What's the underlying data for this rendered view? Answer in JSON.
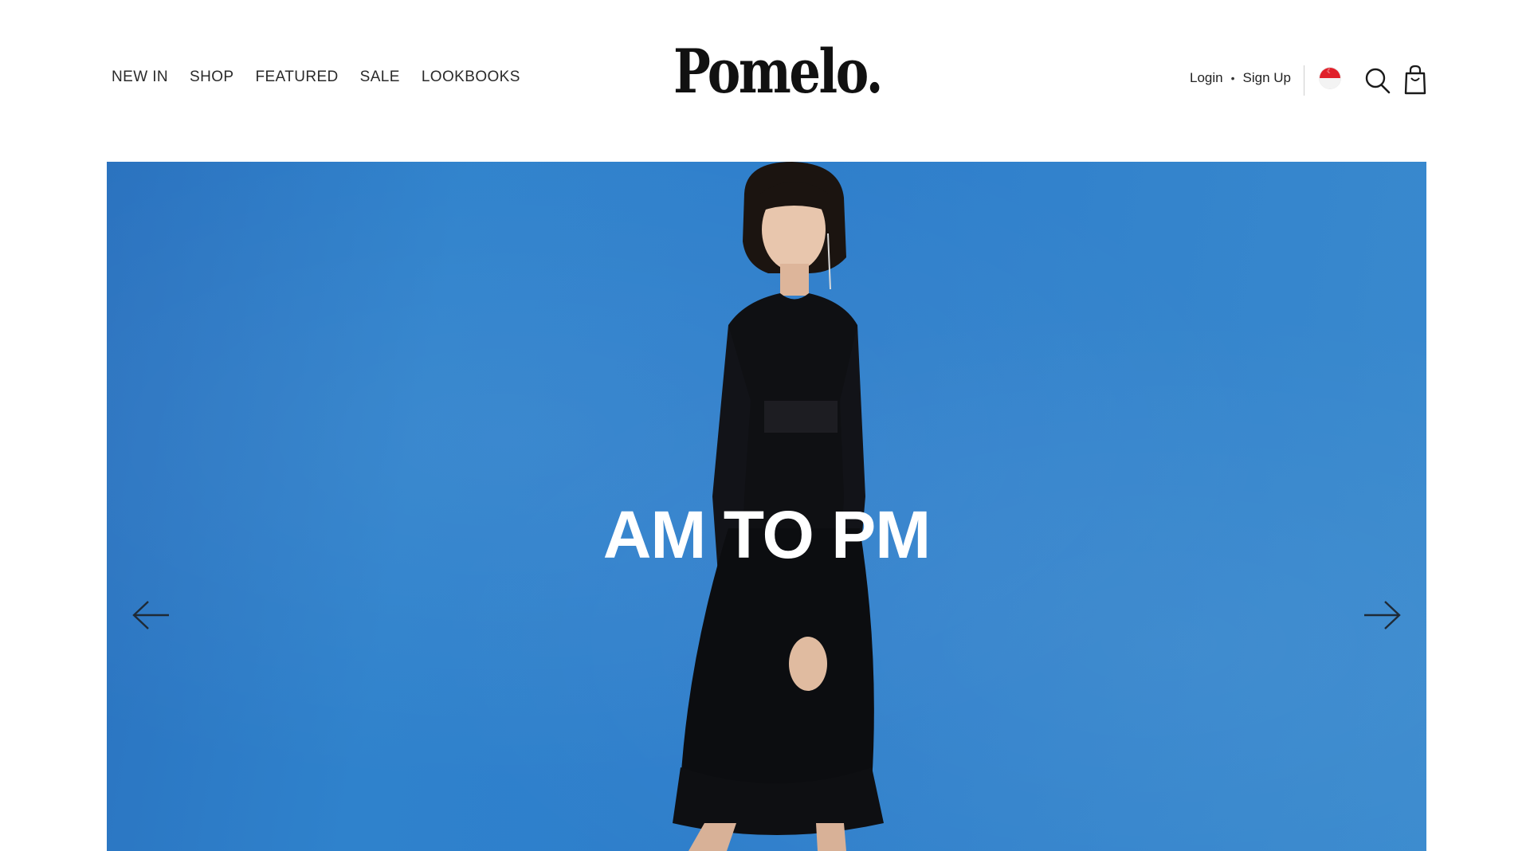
{
  "header": {
    "nav": [
      {
        "label": "NEW IN"
      },
      {
        "label": "SHOP"
      },
      {
        "label": "FEATURED"
      },
      {
        "label": "SALE"
      },
      {
        "label": "LOOKBOOKS"
      }
    ],
    "logo": "Pomelo.",
    "account": {
      "login_label": "Login",
      "separator": "•",
      "signup_label": "Sign Up"
    },
    "icons": {
      "region": "singapore-flag-icon",
      "search": "search-icon",
      "cart": "shopping-bag-icon"
    }
  },
  "hero": {
    "title": "AM TO PM",
    "background_color": "#2f80cc",
    "prev_icon": "arrow-left-icon",
    "next_icon": "arrow-right-icon"
  }
}
